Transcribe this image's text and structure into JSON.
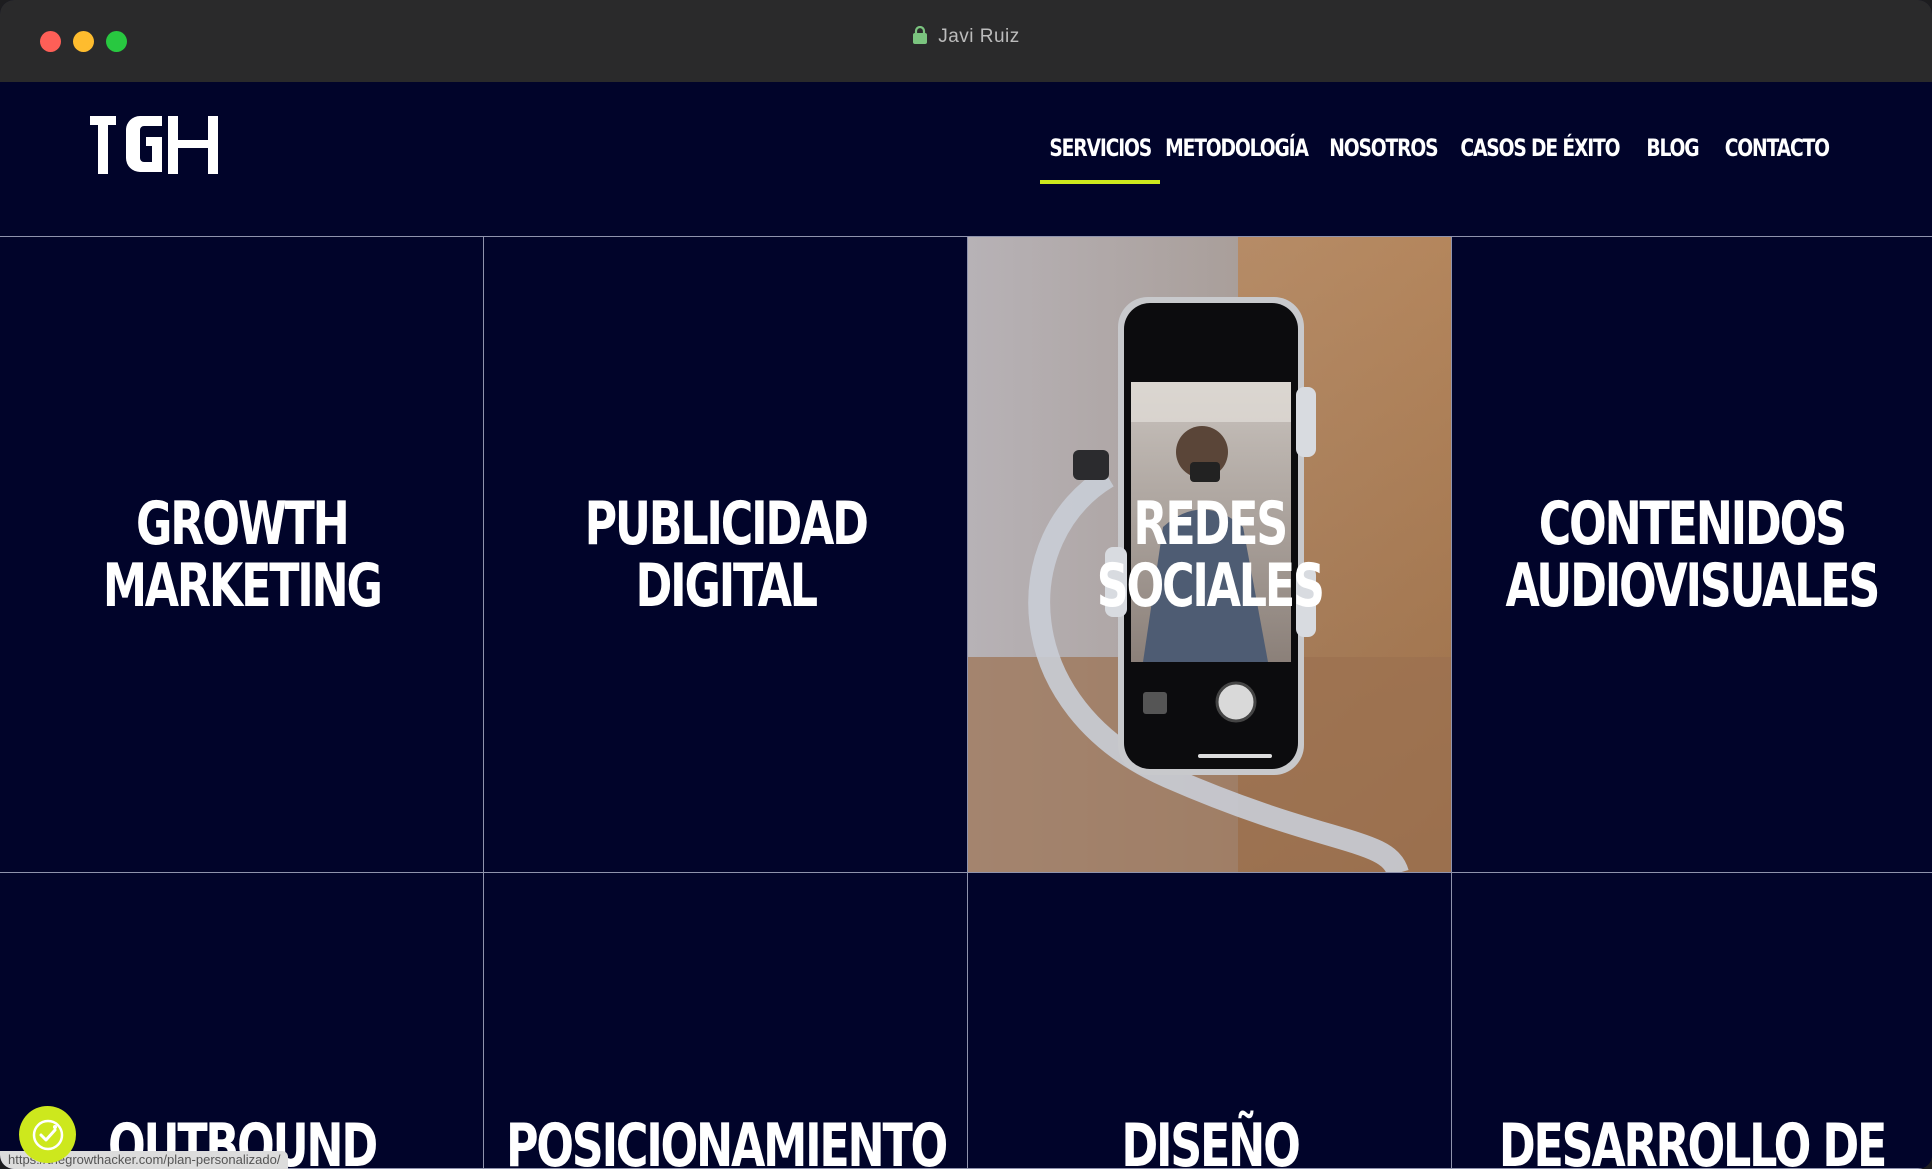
{
  "window": {
    "title": "Javi Ruiz"
  },
  "header": {
    "logo_text": "TGH",
    "nav": [
      {
        "label": "SERVICIOS",
        "active": true
      },
      {
        "label": "METODOLOGÍA",
        "active": false
      },
      {
        "label": "NOSOTROS",
        "active": false
      },
      {
        "label": "CASOS DE ÉXITO",
        "active": false
      },
      {
        "label": "BLOG",
        "active": false
      },
      {
        "label": "CONTACTO",
        "active": false
      }
    ],
    "accent_color": "#cde81d"
  },
  "services": [
    {
      "label": "GROWTH\nMARKETING"
    },
    {
      "label": "PUBLICIDAD\nDIGITAL"
    },
    {
      "label": "REDES\nSOCIALES",
      "has_image": true
    },
    {
      "label": "CONTENIDOS\nAUDIOVISUALES"
    },
    {
      "label": "OUTBOUND"
    },
    {
      "label": "POSICIONAMIENTO"
    },
    {
      "label": "DISEÑO"
    },
    {
      "label": "DESARROLLO DE"
    }
  ],
  "status_bar": {
    "url": "https://thegrowthacker.com/plan-personalizado/"
  },
  "colors": {
    "background": "#01042a",
    "grid_line": "#8f93ad",
    "text": "#ffffff"
  }
}
